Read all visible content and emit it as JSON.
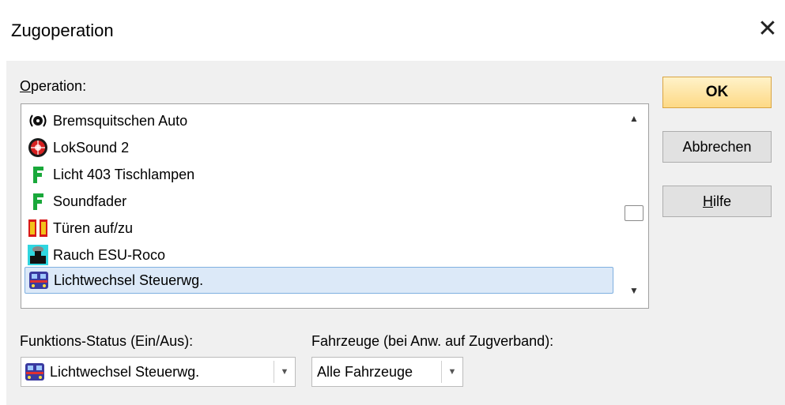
{
  "window": {
    "title": "Zugoperation",
    "close_glyph": "✕"
  },
  "operation": {
    "label_accel": "O",
    "label_rest": "peration:",
    "items": [
      {
        "label": "Bremsquitschen Auto",
        "icon": "brake-sound-icon"
      },
      {
        "label": "LokSound 2",
        "icon": "loksound-icon"
      },
      {
        "label": "Licht 403 Tischlampen",
        "icon": "function-f-icon"
      },
      {
        "label": "Soundfader",
        "icon": "function-f-icon"
      },
      {
        "label": "Türen auf/zu",
        "icon": "doors-icon"
      },
      {
        "label": "Rauch ESU-Roco",
        "icon": "smoke-generator-icon"
      },
      {
        "label": "Lichtwechsel Steuerwg.",
        "icon": "control-car-icon",
        "selected": true
      }
    ]
  },
  "buttons": {
    "ok": "OK",
    "cancel": "Abbrechen",
    "help_accel": "H",
    "help_rest": "ilfe"
  },
  "status": {
    "label": "Funktions-Status (Ein/Aus):",
    "value": "Lichtwechsel Steuerwg.",
    "icon": "control-car-icon"
  },
  "vehicles": {
    "label": "Fahrzeuge (bei Anw. auf Zugverband):",
    "value": "Alle Fahrzeuge"
  },
  "colors": {
    "ok_button": "#fdd985",
    "selection": "#dce9f8",
    "dialog_bg": "#f0f0f0"
  }
}
